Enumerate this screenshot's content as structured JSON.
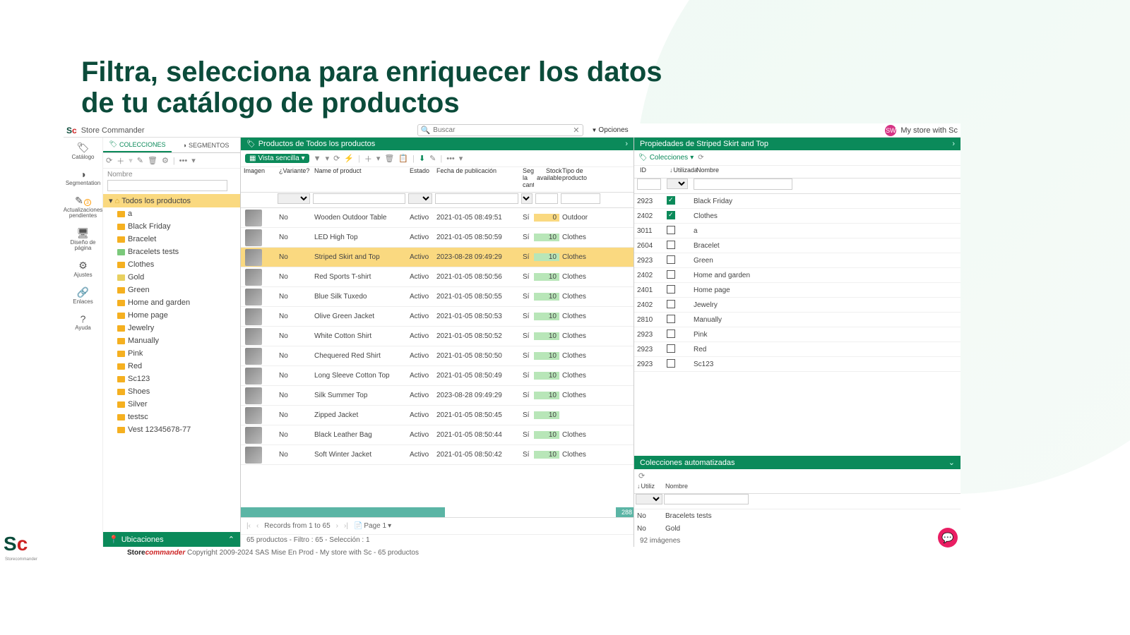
{
  "page_heading": "Filtra, selecciona para enriquecer los datos\nde tu catálogo de productos",
  "header": {
    "app_name": "Store Commander",
    "search_placeholder": "Buscar",
    "options_label": "Opciones",
    "store_name": "My store with Sc",
    "avatar_initials": "SW"
  },
  "vnav": [
    {
      "icon": "🏷",
      "label": "Catálogo"
    },
    {
      "icon": "◑",
      "label": "Segmentation"
    },
    {
      "icon": "✎",
      "label": "Actualizaciones pendientes",
      "badge": "3"
    },
    {
      "icon": "🖥",
      "label": "Diseño de página"
    },
    {
      "icon": "⚙",
      "label": "Ajustes"
    },
    {
      "icon": "🔗",
      "label": "Enlaces"
    },
    {
      "icon": "?",
      "label": "Ayuda"
    }
  ],
  "sidebar": {
    "tab_collections": "COLECCIONES",
    "tab_segments": "SEGMENTOS",
    "filter_label": "Nombre",
    "root_label": "Todos los productos",
    "items": [
      {
        "type": "folder",
        "label": "a"
      },
      {
        "type": "folder",
        "label": "Black Friday"
      },
      {
        "type": "folder",
        "label": "Bracelet"
      },
      {
        "type": "tag-green",
        "label": "Bracelets tests"
      },
      {
        "type": "folder",
        "label": "Clothes"
      },
      {
        "type": "tag-yellow",
        "label": "Gold"
      },
      {
        "type": "folder",
        "label": "Green"
      },
      {
        "type": "folder",
        "label": "Home and garden"
      },
      {
        "type": "folder",
        "label": "Home page"
      },
      {
        "type": "folder",
        "label": "Jewelry"
      },
      {
        "type": "folder",
        "label": "Manually"
      },
      {
        "type": "folder",
        "label": "Pink"
      },
      {
        "type": "folder",
        "label": "Red"
      },
      {
        "type": "folder",
        "label": "Sc123"
      },
      {
        "type": "folder",
        "label": "Shoes"
      },
      {
        "type": "folder",
        "label": "Silver"
      },
      {
        "type": "folder",
        "label": "testsc"
      },
      {
        "type": "folder",
        "label": "Vest 12345678-77"
      }
    ],
    "ubicaciones": "Ubicaciones"
  },
  "products": {
    "panel_title": "Productos de Todos los productos",
    "vista_label": "Vista sencilla",
    "columns": {
      "imagen": "Imagen",
      "variante": "¿Variante?",
      "name": "Name of product",
      "estado": "Estado",
      "fecha": "Fecha de publicación",
      "seguir": "Seguir la cantida",
      "stock": "Stock available",
      "tipo": "Tipo de producto"
    },
    "rows": [
      {
        "variante": "No",
        "name": "Wooden Outdoor Table",
        "estado": "Activo",
        "fecha": "2021-01-05 08:49:51",
        "seg": "Sí",
        "stock": "0",
        "tipo": "Outdoor"
      },
      {
        "variante": "No",
        "name": "LED High Top",
        "estado": "Activo",
        "fecha": "2021-01-05 08:50:59",
        "seg": "Sí",
        "stock": "10",
        "tipo": "Clothes"
      },
      {
        "variante": "No",
        "name": "Striped Skirt and Top",
        "estado": "Activo",
        "fecha": "2023-08-28 09:49:29",
        "seg": "Sí",
        "stock": "10",
        "tipo": "Clothes",
        "selected": true
      },
      {
        "variante": "No",
        "name": "Red Sports T-shirt",
        "estado": "Activo",
        "fecha": "2021-01-05 08:50:56",
        "seg": "Sí",
        "stock": "10",
        "tipo": "Clothes"
      },
      {
        "variante": "No",
        "name": "Blue Silk Tuxedo",
        "estado": "Activo",
        "fecha": "2021-01-05 08:50:55",
        "seg": "Sí",
        "stock": "10",
        "tipo": "Clothes"
      },
      {
        "variante": "No",
        "name": "Olive Green Jacket",
        "estado": "Activo",
        "fecha": "2021-01-05 08:50:53",
        "seg": "Sí",
        "stock": "10",
        "tipo": "Clothes"
      },
      {
        "variante": "No",
        "name": "White Cotton Shirt",
        "estado": "Activo",
        "fecha": "2021-01-05 08:50:52",
        "seg": "Sí",
        "stock": "10",
        "tipo": "Clothes"
      },
      {
        "variante": "No",
        "name": "Chequered Red Shirt",
        "estado": "Activo",
        "fecha": "2021-01-05 08:50:50",
        "seg": "Sí",
        "stock": "10",
        "tipo": "Clothes"
      },
      {
        "variante": "No",
        "name": "Long Sleeve Cotton Top",
        "estado": "Activo",
        "fecha": "2021-01-05 08:50:49",
        "seg": "Sí",
        "stock": "10",
        "tipo": "Clothes"
      },
      {
        "variante": "No",
        "name": "Silk Summer Top",
        "estado": "Activo",
        "fecha": "2023-08-28 09:49:29",
        "seg": "Sí",
        "stock": "10",
        "tipo": "Clothes"
      },
      {
        "variante": "No",
        "name": "Zipped Jacket",
        "estado": "Activo",
        "fecha": "2021-01-05 08:50:45",
        "seg": "Sí",
        "stock": "10",
        "tipo": ""
      },
      {
        "variante": "No",
        "name": "Black Leather Bag",
        "estado": "Activo",
        "fecha": "2021-01-05 08:50:44",
        "seg": "Sí",
        "stock": "10",
        "tipo": "Clothes"
      },
      {
        "variante": "No",
        "name": "Soft Winter Jacket",
        "estado": "Activo",
        "fecha": "2021-01-05 08:50:42",
        "seg": "Sí",
        "stock": "10",
        "tipo": "Clothes"
      }
    ],
    "stock_total": "288",
    "pager_label": "Records from 1 to 65",
    "page_label": "Page 1",
    "status": "65 productos - Filtro : 65 - Selección : 1"
  },
  "props": {
    "panel_title": "Propiedades de Striped Skirt and Top",
    "pill_label": "Colecciones",
    "cols": {
      "id": "ID",
      "used": "Utilizada",
      "name": "Nombre"
    },
    "rows": [
      {
        "id": "2923",
        "used": true,
        "name": "Black Friday"
      },
      {
        "id": "2402",
        "used": true,
        "name": "Clothes"
      },
      {
        "id": "3011",
        "used": false,
        "name": "a"
      },
      {
        "id": "2604",
        "used": false,
        "name": "Bracelet"
      },
      {
        "id": "2923",
        "used": false,
        "name": "Green"
      },
      {
        "id": "2402",
        "used": false,
        "name": "Home and garden"
      },
      {
        "id": "2401",
        "used": false,
        "name": "Home page"
      },
      {
        "id": "2402",
        "used": false,
        "name": "Jewelry"
      },
      {
        "id": "2810",
        "used": false,
        "name": "Manually"
      },
      {
        "id": "2923",
        "used": false,
        "name": "Pink"
      },
      {
        "id": "2923",
        "used": false,
        "name": "Red"
      },
      {
        "id": "2923",
        "used": false,
        "name": "Sc123"
      }
    ],
    "auto_title": "Colecciones automatizadas",
    "auto_cols": {
      "util": "Utiliz",
      "nombre": "Nombre"
    },
    "auto_rows": [
      {
        "util": "No",
        "name": "Bracelets tests"
      },
      {
        "util": "No",
        "name": "Gold"
      }
    ],
    "images_count": "92 imágenes"
  },
  "footer": {
    "brand": "Storecommander",
    "copyright": " Copyright 2009-2024 SAS Mise En Prod - My store with Sc - 65 productos"
  }
}
